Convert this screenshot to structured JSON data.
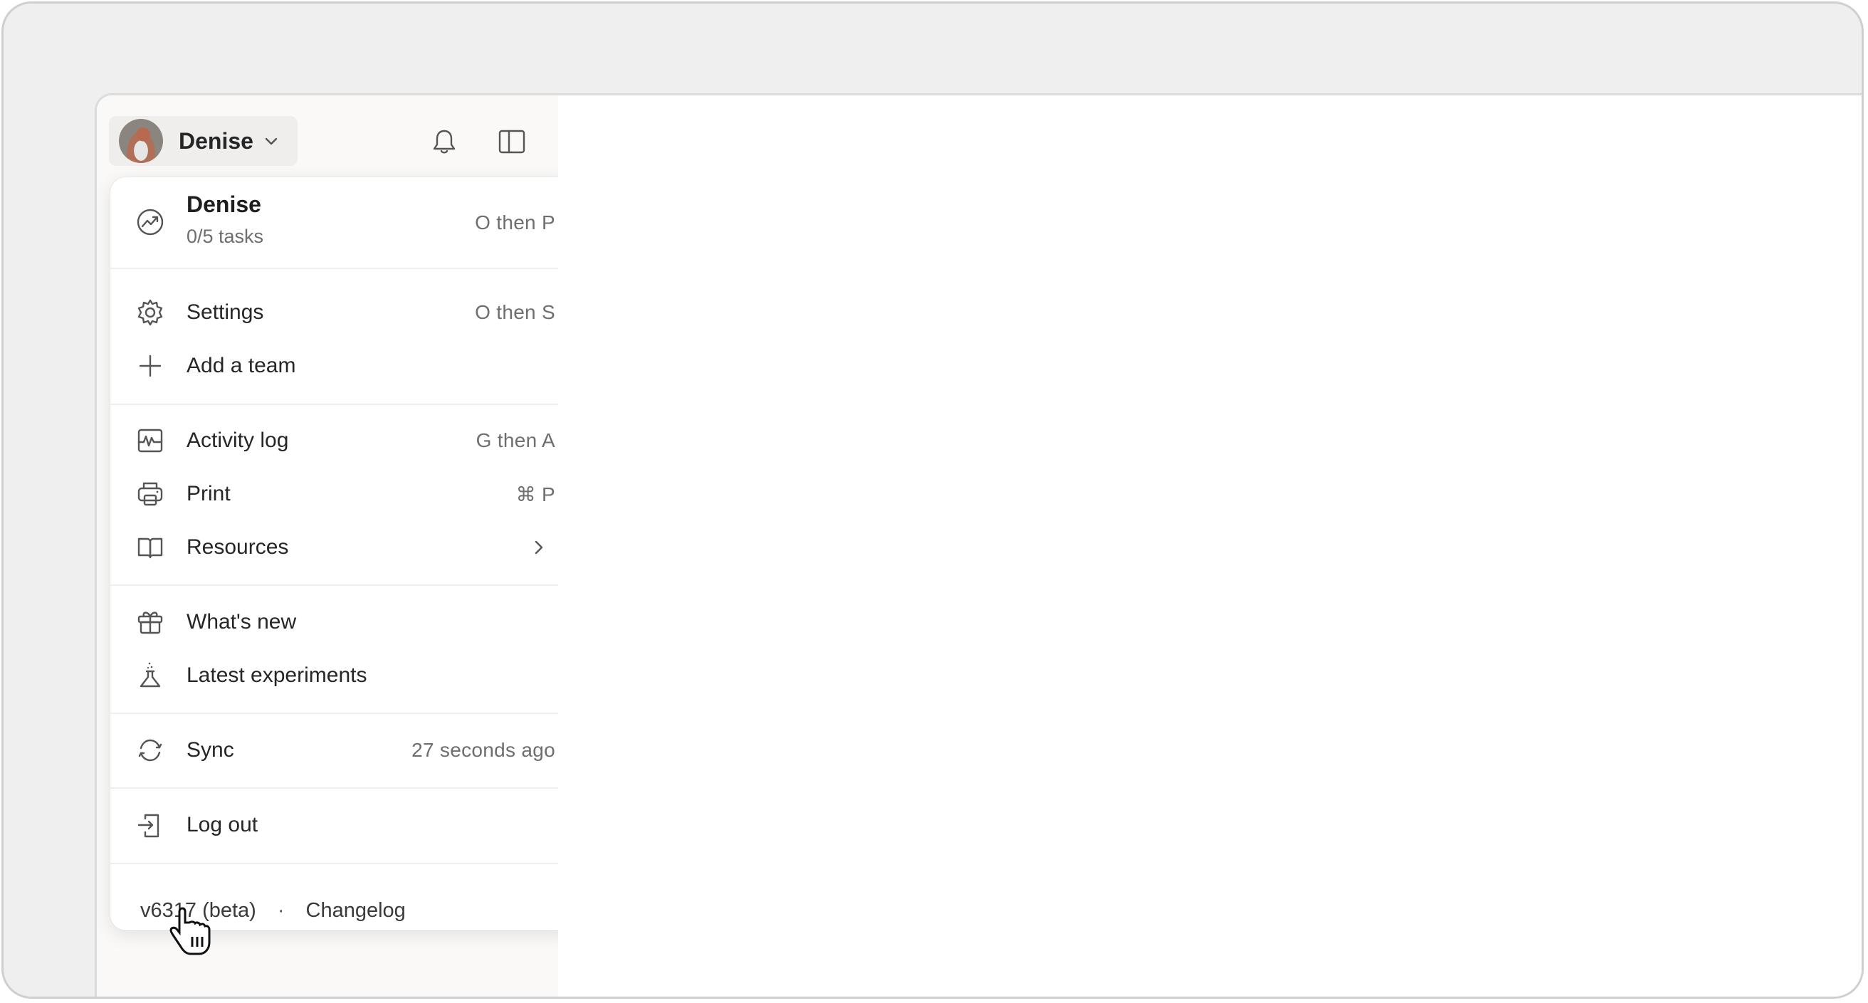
{
  "header": {
    "user_name": "Denise",
    "icons": {
      "notifications": "bell-icon",
      "sidebar_toggle": "sidebar-panel-icon"
    }
  },
  "menu": {
    "profile": {
      "name": "Denise",
      "subtitle": "0/5 tasks",
      "shortcut": "O then P",
      "icon": "productivity-chart-icon"
    },
    "items": [
      {
        "label": "Settings",
        "shortcut": "O then S",
        "icon": "gear-icon"
      },
      {
        "label": "Add a team",
        "shortcut": "",
        "icon": "plus-icon"
      },
      {
        "label": "Activity log",
        "shortcut": "G then A",
        "icon": "activity-icon"
      },
      {
        "label": "Print",
        "shortcut": "⌘ P",
        "icon": "printer-icon"
      },
      {
        "label": "Resources",
        "shortcut": "",
        "icon": "book-icon",
        "submenu": true
      },
      {
        "label": "What's new",
        "shortcut": "",
        "icon": "gift-icon"
      },
      {
        "label": "Latest experiments",
        "shortcut": "",
        "icon": "flask-icon"
      },
      {
        "label": "Sync",
        "shortcut": "27 seconds ago",
        "icon": "sync-icon"
      },
      {
        "label": "Log out",
        "shortcut": "",
        "icon": "logout-icon"
      }
    ],
    "footer": {
      "version": "v6317 (beta)",
      "separator": "·",
      "changelog": "Changelog"
    }
  },
  "colors": {
    "sidebar_bg": "#faf9f8",
    "frame_bg": "#efefef",
    "text": "#262626",
    "muted": "#6e6e6e"
  }
}
